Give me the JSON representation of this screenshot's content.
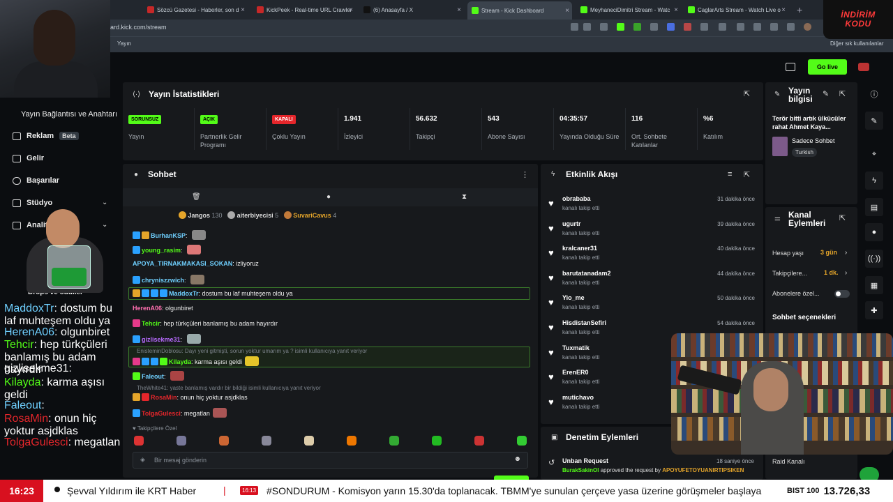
{
  "browser": {
    "tabs": [
      {
        "label": "Sözcü Gazetesi - Haberler, son d",
        "color": "#c62828"
      },
      {
        "label": "KickPeek - Real-time URL Crawler",
        "color": "#c62828"
      },
      {
        "label": "(6) Anasayfa / X",
        "color": "#111111"
      },
      {
        "label": "Stream - Kick Dashboard",
        "color": "#53fc18"
      },
      {
        "label": "MeyhaneciDimitri Stream - Watc",
        "color": "#53fc18"
      },
      {
        "label": "CaglarArts Stream - Watch Live o",
        "color": "#53fc18"
      }
    ],
    "url": "ard.kick.com/stream",
    "bookmark": "Yayın",
    "other_bookmarks": "Diğer sık kullanılanlar"
  },
  "promo": {
    "line1": "İNDİRİM",
    "line2": "KODU"
  },
  "header": {
    "go_live": "Go live"
  },
  "nav": {
    "section": "Yayın Bağlantısı ve Anahtarı",
    "items": [
      {
        "label": "Reklam",
        "badge": "Beta"
      },
      {
        "label": "Gelir"
      },
      {
        "label": "Başarılar"
      },
      {
        "label": "Stüdyo"
      },
      {
        "label": "Analitik"
      },
      {
        "label": "Drops ve ödüller"
      }
    ]
  },
  "stats": {
    "title": "Yayın İstatistikleri",
    "cells": [
      {
        "value": "SORUNSUZ",
        "label": "Yayın",
        "pill": "#53fc18"
      },
      {
        "value": "AÇIK",
        "label": "Partnerlik Gelir Programı",
        "pill": "#53fc18"
      },
      {
        "value": "KAPALI",
        "label": "Çoklu Yayın",
        "pill": "#e5262b"
      },
      {
        "value": "1.941",
        "label": "İzleyici"
      },
      {
        "value": "56.632",
        "label": "Takipçi"
      },
      {
        "value": "543",
        "label": "Abone Sayısı"
      },
      {
        "value": "04:35:57",
        "label": "Yayında Olduğu Süre"
      },
      {
        "value": "116",
        "label": "Ort. Sohbete Katılanlar"
      },
      {
        "value": "%6",
        "label": "Katılım"
      }
    ]
  },
  "stream_info": {
    "title": "Yayın bilgisi",
    "stream_title": "Terör bitti artık ülkücüler rahat Ahmet Kaya...",
    "category": "Sadece Sohbet",
    "language": "Turkish"
  },
  "chat": {
    "title": "Sohbet",
    "top_gifters": [
      {
        "name": "Jangos",
        "count": "130"
      },
      {
        "name": "aiterbiyecisi",
        "count": "5"
      },
      {
        "name": "SuvariCavus",
        "count": "4"
      }
    ],
    "messages": [
      {
        "user": "BurhanKSP",
        "color": "#6fd0ff",
        "text": ""
      },
      {
        "user": "young_rasim",
        "color": "#53fc18",
        "text": ""
      },
      {
        "user": "APOYA_TIRNAKMAKASI_SOKAN",
        "color": "#6fd0ff",
        "text": "izliyoruz"
      },
      {
        "user": "chryniszzwich",
        "color": "#6fd0ff",
        "text": ""
      },
      {
        "user": "MaddoxTr",
        "color": "#6fd0ff",
        "text": "dostum bu laf muhteşem oldu ya"
      },
      {
        "user": "HerenA06",
        "color": "#ff6fb0",
        "text": "olgunbiret"
      },
      {
        "user": "Tehcir",
        "color": "#53fc18",
        "text": "hep türkçüleri banlamış bu adam hayırdır"
      },
      {
        "user": "gizlisekme31",
        "color": "#b86bff",
        "text": ""
      },
      {
        "user": "Kilayda",
        "color": "#53fc18",
        "text": "karma aşısı geldi"
      },
      {
        "user": "Faleout",
        "color": "#6fd0ff",
        "text": ""
      },
      {
        "user": "RosaMin",
        "color": "#e5262b",
        "text": "onun hiç yoktur asjdklas"
      },
      {
        "user": "TolgaGulesci",
        "color": "#e5262b",
        "text": "megatlan"
      }
    ],
    "reply_refs": [
      "EnisteminDoblosu: Dayı yeni gitmişti, sorun yoktur umarım ya ? isimli kullanıcıya yanıt veriyor",
      "TheWhite41: yaste banlamış vardır bir bildiği isimli kullanıcıya yanıt veriyor"
    ],
    "followers_label": "Takipçilere Özel",
    "input_placeholder": "Bir mesaj gönderin"
  },
  "activity": {
    "title": "Etkinlik Akışı",
    "items": [
      {
        "name": "obrababa",
        "sub": "kanalı takip etti",
        "time": "31 dakika önce"
      },
      {
        "name": "ugurtr",
        "sub": "kanalı takip etti",
        "time": "39 dakika önce"
      },
      {
        "name": "kralcaner31",
        "sub": "kanalı takip etti",
        "time": "40 dakika önce"
      },
      {
        "name": "barutatanadam2",
        "sub": "kanalı takip etti",
        "time": "44 dakika önce"
      },
      {
        "name": "Yio_me",
        "sub": "kanalı takip etti",
        "time": "50 dakika önce"
      },
      {
        "name": "HisdistanSefiri",
        "sub": "kanalı takip etti",
        "time": "54 dakika önce"
      },
      {
        "name": "Tuxmatik",
        "sub": "kanalı takip etti",
        "time": ""
      },
      {
        "name": "ErenER0",
        "sub": "kanalı takip etti",
        "time": ""
      },
      {
        "name": "mutichavo",
        "sub": "kanalı takip etti",
        "time": ""
      }
    ]
  },
  "moderation": {
    "title": "Denetim Eylemleri",
    "item_title": "Unban Request",
    "item_time": "18 saniye önce",
    "item_actor": "BurakSakinOl",
    "item_text": "approved the request by",
    "item_target": "APOYUFETOYUANIRTIPSIKEN"
  },
  "channel_actions": {
    "title": "Kanal Eylemleri",
    "account_age_label": "Hesap yaşı",
    "account_age_value": "3 gün",
    "followers_label": "Takipçilere...",
    "followers_value": "1 dk.",
    "subs_label": "Abonelere özel...",
    "chat_options": "Sohbet seçenekleri",
    "raid": "Raid Kanalı"
  },
  "overlay_chat": [
    {
      "user": "MaddoxTr",
      "text": "dostum bu laf muhteşem oldu ya",
      "color": "#6fd0ff"
    },
    {
      "user": "HerenA06",
      "text": "olgunbiret",
      "color": "#6fd0ff"
    },
    {
      "user": "Tehcir",
      "text": "hep türkçüleri banlamış bu adam hayırdır",
      "color": "#53fc18"
    },
    {
      "user": "gizlisekme31",
      "text": "",
      "color": "#fff"
    },
    {
      "user": "Kilayda",
      "text": "karma aşısı geldi",
      "color": "#53fc18"
    },
    {
      "user": "Faleout",
      "text": "",
      "color": "#6fd0ff"
    },
    {
      "user": "RosaMin",
      "text": "onun hiç yoktur asjdklas",
      "color": "#e5262b"
    },
    {
      "user": "TolgaGulesci",
      "text": "megatlan",
      "color": "#e5262b"
    }
  ],
  "ticker": {
    "time": "16:23",
    "text1": "Şevval Yıldırım ile KRT Haber",
    "small_time": "16:13",
    "text2": "#SONDURUM - Komisyon yarın 15.30'da toplanacak. TBMM'ye sunulan çerçeve yasa üzerine görüşmeler başlaya",
    "bist_label": "BIST 100",
    "bist_value": "13.726,33"
  }
}
